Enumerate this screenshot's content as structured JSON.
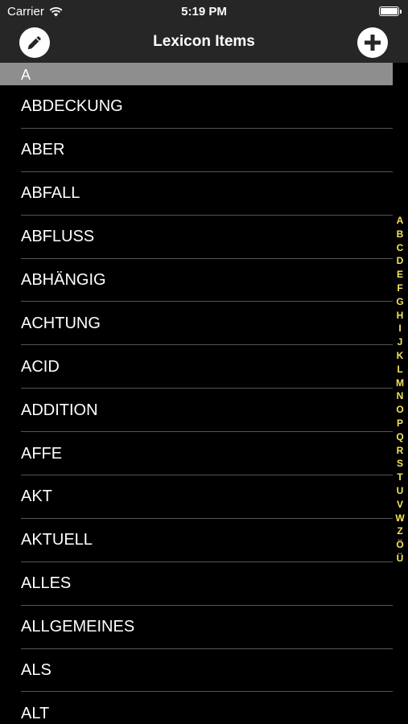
{
  "status_bar": {
    "carrier": "Carrier",
    "time": "5:19 PM"
  },
  "nav": {
    "title": "Lexicon Items",
    "left_icon": "pencil-icon",
    "right_icon": "plus-circle-icon"
  },
  "section": {
    "title": "A"
  },
  "items": [
    "ABDECKUNG",
    "ABER",
    "ABFALL",
    "ABFLUSS",
    "ABHÄNGIG",
    "ACHTUNG",
    "ACID",
    "ADDITION",
    "AFFE",
    "AKT",
    "AKTUELL",
    "ALLES",
    "ALLGEMEINES",
    "ALS",
    "ALT"
  ],
  "index_letters": [
    "A",
    "B",
    "C",
    "D",
    "E",
    "F",
    "G",
    "H",
    "I",
    "J",
    "K",
    "L",
    "M",
    "N",
    "O",
    "P",
    "Q",
    "R",
    "S",
    "T",
    "U",
    "V",
    "W",
    "Z",
    "Ö",
    "Ü"
  ],
  "colors": {
    "index": "#f5e35c",
    "bars": "#262626",
    "section_header": "#8e8e8e",
    "background": "#000000"
  }
}
